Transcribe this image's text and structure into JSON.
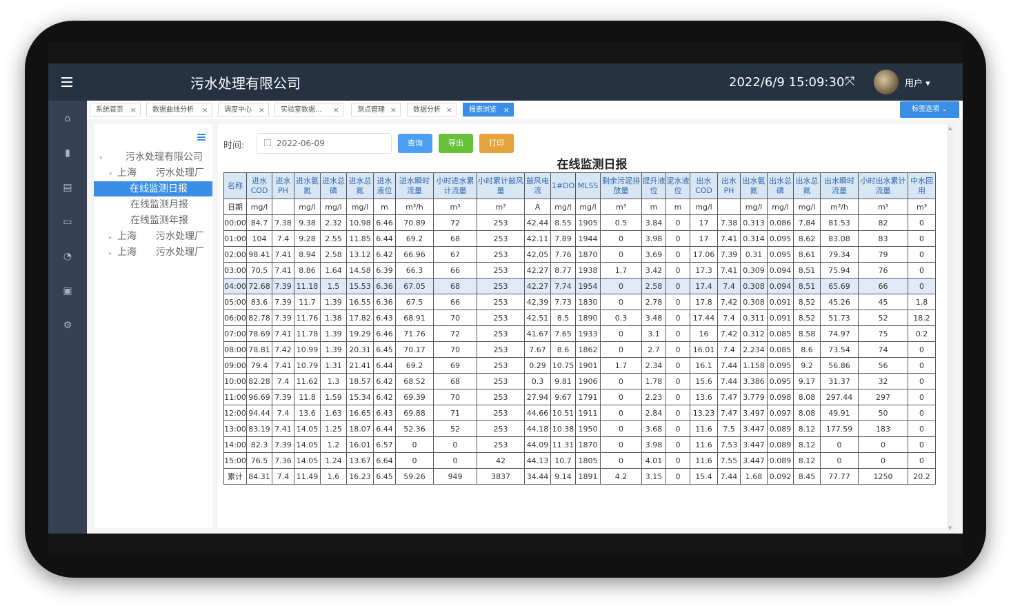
{
  "header": {
    "company": "污水处理有限公司",
    "datetime": "2022/6/9 15:09:30",
    "user": "用户 ▾",
    "menu_icon": "hamburger-icon",
    "fullscreen_icon": "expand-icon"
  },
  "sidebar": {
    "icons": [
      "home-icon",
      "bar-chart-icon",
      "document-icon",
      "monitor-icon",
      "bell-icon",
      "stack-icon",
      "gear-icon"
    ]
  },
  "tabs": [
    {
      "label": "系统首页",
      "active": false
    },
    {
      "label": "数据曲线分析",
      "active": false
    },
    {
      "label": "调度中心",
      "active": false
    },
    {
      "label": "实验室数据...",
      "active": false
    },
    {
      "label": "测点管理",
      "active": false
    },
    {
      "label": "数据分析",
      "active": false
    },
    {
      "label": "报表浏览",
      "active": true
    }
  ],
  "tag_options": "标签选项 ⌄",
  "tree": {
    "root": "污水处理有限公司",
    "plants": [
      {
        "city": "上海",
        "plant": "污水处理厂",
        "expanded": true,
        "children": [
          "在线监测日报",
          "在线监测月报",
          "在线监测年报"
        ],
        "selected": "在线监测日报"
      },
      {
        "city": "上海",
        "plant": "污水处理厂",
        "expanded": false
      },
      {
        "city": "上海",
        "plant": "污水处理厂",
        "expanded": false
      }
    ]
  },
  "filters": {
    "time_label": "时间:",
    "date_value": "2022-06-09",
    "query": "查询",
    "export": "导出",
    "print": "打印"
  },
  "colors": {
    "query": "#4a9ff5",
    "export": "#67c23a",
    "print": "#e6a23c",
    "header_bg": "#263142",
    "sidebar_bg": "#364254",
    "accent": "#3a8ee6"
  },
  "report": {
    "title": "在线监测日报",
    "headers": [
      "名称",
      "进水COD",
      "进水PH",
      "进水氨氮",
      "进水总磷",
      "进水总氮",
      "进水液位",
      "进水瞬时流量",
      "小时进水累计流量",
      "小时累计鼓风量",
      "鼓风电流",
      "1#DO",
      "MLSS",
      "剩余污泥排放量",
      "提升液位",
      "泥水液位",
      "出水COD",
      "出水PH",
      "出水氨氮",
      "出水总磷",
      "出水总氮",
      "出水瞬时流量",
      "小时出水累计流量",
      "中水回用"
    ],
    "units": [
      "日期",
      "mg/l",
      "",
      "mg/l",
      "mg/l",
      "mg/l",
      "m",
      "m³/h",
      "m³",
      "m³",
      "A",
      "mg/l",
      "mg/l",
      "m³",
      "m",
      "m",
      "mg/l",
      "",
      "mg/l",
      "mg/l",
      "mg/l",
      "m³/h",
      "m³",
      "m³"
    ],
    "highlight_row": 4,
    "rows": [
      [
        "00:00",
        "84.7",
        "7.38",
        "9.38",
        "2.32",
        "10.98",
        "6.46",
        "70.89",
        "72",
        "253",
        "42.44",
        "8.55",
        "1905",
        "0.5",
        "3.84",
        "0",
        "17",
        "7.38",
        "0.313",
        "0.086",
        "7.84",
        "81.53",
        "82",
        "0"
      ],
      [
        "01:00",
        "104",
        "7.4",
        "9.28",
        "2.55",
        "11.85",
        "6.44",
        "69.2",
        "68",
        "253",
        "42.11",
        "7.89",
        "1944",
        "0",
        "3.98",
        "0",
        "17",
        "7.41",
        "0.314",
        "0.095",
        "8.62",
        "83.08",
        "83",
        "0"
      ],
      [
        "02:00",
        "98.41",
        "7.41",
        "8.94",
        "2.58",
        "13.12",
        "6.42",
        "66.96",
        "67",
        "253",
        "42.05",
        "7.76",
        "1870",
        "0",
        "3.69",
        "0",
        "17.06",
        "7.39",
        "0.31",
        "0.095",
        "8.61",
        "79.34",
        "79",
        "0"
      ],
      [
        "03:00",
        "70.5",
        "7.41",
        "8.86",
        "1.64",
        "14.58",
        "6.39",
        "66.3",
        "66",
        "253",
        "42.27",
        "8.77",
        "1938",
        "1.7",
        "3.42",
        "0",
        "17.3",
        "7.41",
        "0.309",
        "0.094",
        "8.51",
        "75.94",
        "76",
        "0"
      ],
      [
        "04:00",
        "72.68",
        "7.39",
        "11.18",
        "1.5",
        "15.53",
        "6.36",
        "67.05",
        "68",
        "253",
        "42.27",
        "7.74",
        "1954",
        "0",
        "2.58",
        "0",
        "17.4",
        "7.4",
        "0.308",
        "0.094",
        "8.51",
        "65.69",
        "66",
        "0"
      ],
      [
        "05:00",
        "83.6",
        "7.39",
        "11.7",
        "1.39",
        "16.55",
        "6.36",
        "67.5",
        "66",
        "253",
        "42.39",
        "7.73",
        "1830",
        "0",
        "2.78",
        "0",
        "17.8",
        "7.42",
        "0.308",
        "0.091",
        "8.52",
        "45.26",
        "45",
        "1.8"
      ],
      [
        "06:00",
        "82.78",
        "7.39",
        "11.76",
        "1.38",
        "17.82",
        "6.43",
        "68.91",
        "70",
        "253",
        "42.51",
        "8.5",
        "1890",
        "0.3",
        "3.48",
        "0",
        "17.44",
        "7.4",
        "0.311",
        "0.091",
        "8.52",
        "51.73",
        "52",
        "18.2"
      ],
      [
        "07:00",
        "78.69",
        "7.41",
        "11.78",
        "1.39",
        "19.29",
        "6.46",
        "71.76",
        "72",
        "253",
        "41.67",
        "7.65",
        "1933",
        "0",
        "3.1",
        "0",
        "16",
        "7.42",
        "0.312",
        "0.085",
        "8.58",
        "74.97",
        "75",
        "0.2"
      ],
      [
        "08:00",
        "78.81",
        "7.42",
        "10.99",
        "1.39",
        "20.31",
        "6.45",
        "70.17",
        "70",
        "253",
        "7.67",
        "8.6",
        "1862",
        "0",
        "2.7",
        "0",
        "16.01",
        "7.4",
        "2.234",
        "0.085",
        "8.6",
        "73.54",
        "74",
        "0"
      ],
      [
        "09:00",
        "79.4",
        "7.41",
        "10.79",
        "1.31",
        "21.41",
        "6.44",
        "69.2",
        "69",
        "253",
        "0.29",
        "10.75",
        "1901",
        "1.7",
        "2.34",
        "0",
        "16.1",
        "7.44",
        "1.158",
        "0.095",
        "9.2",
        "56.86",
        "56",
        "0"
      ],
      [
        "10:00",
        "82.28",
        "7.4",
        "11.62",
        "1.3",
        "18.57",
        "6.42",
        "68.52",
        "68",
        "253",
        "0.3",
        "9.81",
        "1906",
        "0",
        "1.78",
        "0",
        "15.6",
        "7.44",
        "3.386",
        "0.095",
        "9.17",
        "31.37",
        "32",
        "0"
      ],
      [
        "11:00",
        "96.69",
        "7.39",
        "11.8",
        "1.59",
        "15.34",
        "6.42",
        "69.39",
        "70",
        "253",
        "27.94",
        "9.67",
        "1791",
        "0",
        "2.23",
        "0",
        "13.6",
        "7.47",
        "3.779",
        "0.098",
        "8.08",
        "297.44",
        "297",
        "0"
      ],
      [
        "12:00",
        "94.44",
        "7.4",
        "13.6",
        "1.63",
        "16.65",
        "6.43",
        "69.88",
        "71",
        "253",
        "44.66",
        "10.51",
        "1911",
        "0",
        "2.84",
        "0",
        "13.23",
        "7.47",
        "3.497",
        "0.097",
        "8.08",
        "49.91",
        "50",
        "0"
      ],
      [
        "13:00",
        "83.19",
        "7.41",
        "14.05",
        "1.25",
        "18.07",
        "6.44",
        "52.36",
        "52",
        "253",
        "44.18",
        "10.38",
        "1950",
        "0",
        "3.68",
        "0",
        "11.6",
        "7.5",
        "3.447",
        "0.089",
        "8.12",
        "177.59",
        "183",
        "0"
      ],
      [
        "14:00",
        "82.3",
        "7.39",
        "14.05",
        "1.2",
        "16.01",
        "6.57",
        "0",
        "0",
        "253",
        "44.09",
        "11.31",
        "1870",
        "0",
        "3.98",
        "0",
        "11.6",
        "7.53",
        "3.447",
        "0.089",
        "8.12",
        "0",
        "0",
        "0"
      ],
      [
        "15:00",
        "76.5",
        "7.36",
        "14.05",
        "1.24",
        "13.67",
        "6.64",
        "0",
        "0",
        "42",
        "44.13",
        "10.7",
        "1805",
        "0",
        "4.01",
        "0",
        "11.6",
        "7.55",
        "3.447",
        "0.089",
        "8.12",
        "0",
        "0",
        "0"
      ],
      [
        "累计",
        "84.31",
        "7.4",
        "11.49",
        "1.6",
        "16.23",
        "6.45",
        "59.26",
        "949",
        "3837",
        "34.44",
        "9.14",
        "1891",
        "4.2",
        "3.15",
        "0",
        "15.4",
        "7.44",
        "1.68",
        "0.092",
        "8.45",
        "77.77",
        "1250",
        "20.2"
      ]
    ]
  }
}
